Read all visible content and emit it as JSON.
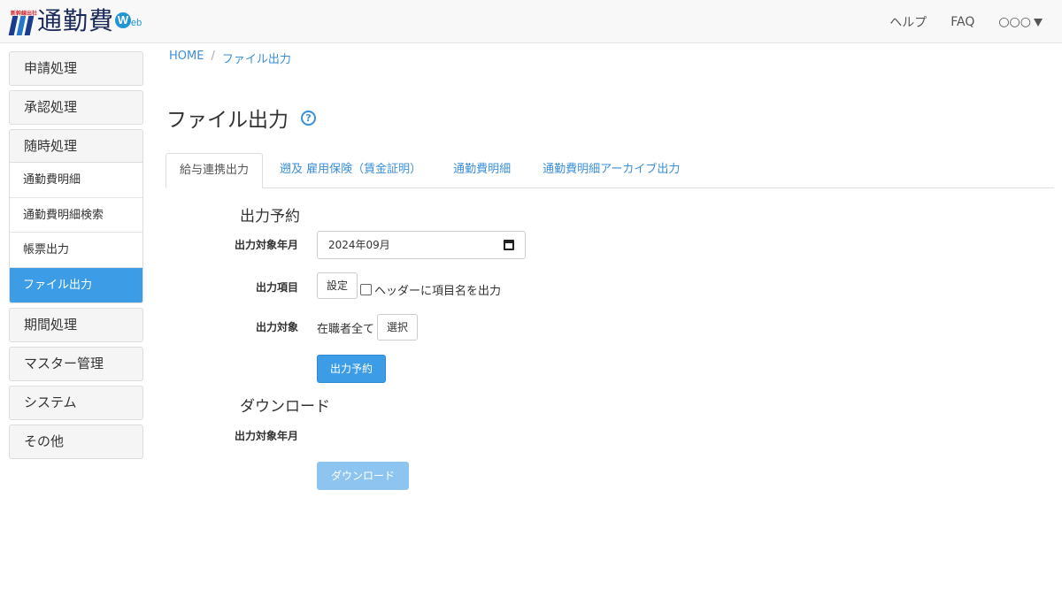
{
  "header": {
    "logo_tiny": "新幹線出社",
    "logo_text": "通勤費",
    "logo_badge": "W",
    "logo_suffix": "eb",
    "nav": {
      "help": "ヘルプ",
      "faq": "FAQ",
      "user": "○○○"
    }
  },
  "sidebar": {
    "groups": {
      "shinsei": "申請処理",
      "shounin": "承認処理",
      "zuiji": "随時処理",
      "kikan": "期間処理",
      "master": "マスター管理",
      "system": "システム",
      "other": "その他"
    },
    "zuiji_items": [
      "通勤費明細",
      "通勤費明細検索",
      "帳票出力",
      "ファイル出力"
    ],
    "active_item": "ファイル出力"
  },
  "breadcrumb": {
    "home": "HOME",
    "sep": "/",
    "current": "ファイル出力"
  },
  "page_title": "ファイル出力",
  "help_icon": "?",
  "tabs": [
    "給与連携出力",
    "遡及 雇用保険（賃金証明）",
    "通勤費明細",
    "通勤費明細アーカイブ出力"
  ],
  "active_tab": "給与連携出力",
  "reserve": {
    "title": "出力予約",
    "month_label": "出力対象年月",
    "month_value": "2024年09月",
    "items_label": "出力項目",
    "settings_button": "設定",
    "header_checkbox_label": "ヘッダーに項目名を出力",
    "header_checkbox_checked": false,
    "target_label": "出力対象",
    "target_value": "在職者全て",
    "select_button": "選択",
    "submit_button": "出力予約"
  },
  "download": {
    "title": "ダウンロード",
    "month_label": "出力対象年月",
    "button": "ダウンロード",
    "button_disabled": true
  },
  "colors": {
    "accent": "#3c9de6",
    "link": "#3a8fd8",
    "disabled": "#8ec5f0"
  }
}
